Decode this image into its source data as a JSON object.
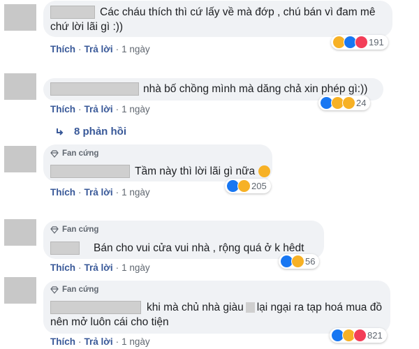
{
  "comments": [
    {
      "lines": [
        "Các cháu thích thì cứ lấy về mà đớp , chú bán vì đam mê",
        "chứ lời lãi gì :))"
      ],
      "like": "Thích",
      "reply": "Trả lời",
      "time": "1 ngày",
      "reactions": [
        "haha",
        "like",
        "love"
      ],
      "count": "191"
    },
    {
      "lines": [
        "nhà bố chồng mình mà dăng chả xin phép gì:))"
      ],
      "like": "Thích",
      "reply": "Trả lời",
      "time": "1 ngày",
      "reactions": [
        "like",
        "haha",
        "sad"
      ],
      "count": "24"
    },
    {
      "badge": "Fan cứng",
      "lines": [
        "Tầm này thì lời lãi gì nữa"
      ],
      "like": "Thích",
      "reply": "Trả lời",
      "time": "1 ngày",
      "reactions": [
        "like",
        "haha"
      ],
      "count": "205"
    },
    {
      "badge": "Fan cứng",
      "lines": [
        "Bán cho vui cửa vui nhà , rộng quá ở k hêdt"
      ],
      "like": "Thích",
      "reply": "Trả lời",
      "time": "1 ngày",
      "reactions": [
        "like",
        "haha"
      ],
      "count": "56"
    },
    {
      "badge": "Fan cứng",
      "lines": [
        "khi mà chủ nhà giàu",
        "lại ngại ra tạp hoá mua đồ",
        "nên mở luôn cái cho tiện"
      ],
      "like": "Thích",
      "reply": "Trả lời",
      "time": "1 ngày",
      "reactions": [
        "like",
        "haha",
        "love"
      ],
      "count": "821"
    }
  ],
  "replies_label": "8 phản hồi",
  "colors": {
    "link": "#385898",
    "bubble": "#f0f2f5",
    "like": "#1877f2",
    "love": "#f33e58",
    "haha": "#f7b125"
  },
  "icons": [
    "reply-arrow-icon",
    "diamond-icon",
    "like-reaction-icon",
    "haha-reaction-icon",
    "love-reaction-icon",
    "sad-reaction-icon"
  ]
}
